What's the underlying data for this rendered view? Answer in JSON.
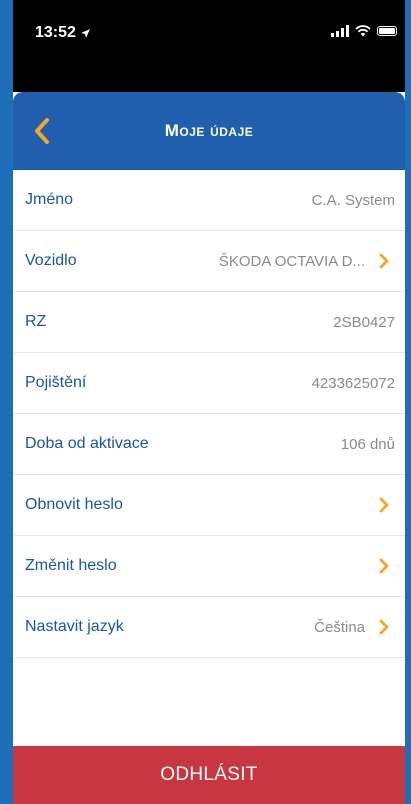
{
  "status_bar": {
    "time": "13:52"
  },
  "header": {
    "title": "Moje údaje",
    "back_icon": "chevron-left-icon"
  },
  "rows": [
    {
      "label": "Jméno",
      "value": "C.A. System",
      "chevron": false
    },
    {
      "label": "Vozidlo",
      "value": "ŠKODA OCTAVIA D...",
      "chevron": true
    },
    {
      "label": "RZ",
      "value": "2SB0427",
      "chevron": false
    },
    {
      "label": "Pojištění",
      "value": "4233625072",
      "chevron": false
    },
    {
      "label": "Doba od aktivace",
      "value": "106 dnů",
      "chevron": false
    },
    {
      "label": "Obnovit heslo",
      "value": "",
      "chevron": true
    },
    {
      "label": "Změnit heslo",
      "value": "",
      "chevron": true
    },
    {
      "label": "Nastavit jazyk",
      "value": "Čeština",
      "chevron": true
    }
  ],
  "logout_label": "ODHLÁSIT",
  "colors": {
    "frame_blue": "#1f6fb8",
    "header_blue": "#1f5fae",
    "label_blue": "#1a56a4",
    "chevron_orange": "#f6a623",
    "logout_red": "#c8373f"
  }
}
